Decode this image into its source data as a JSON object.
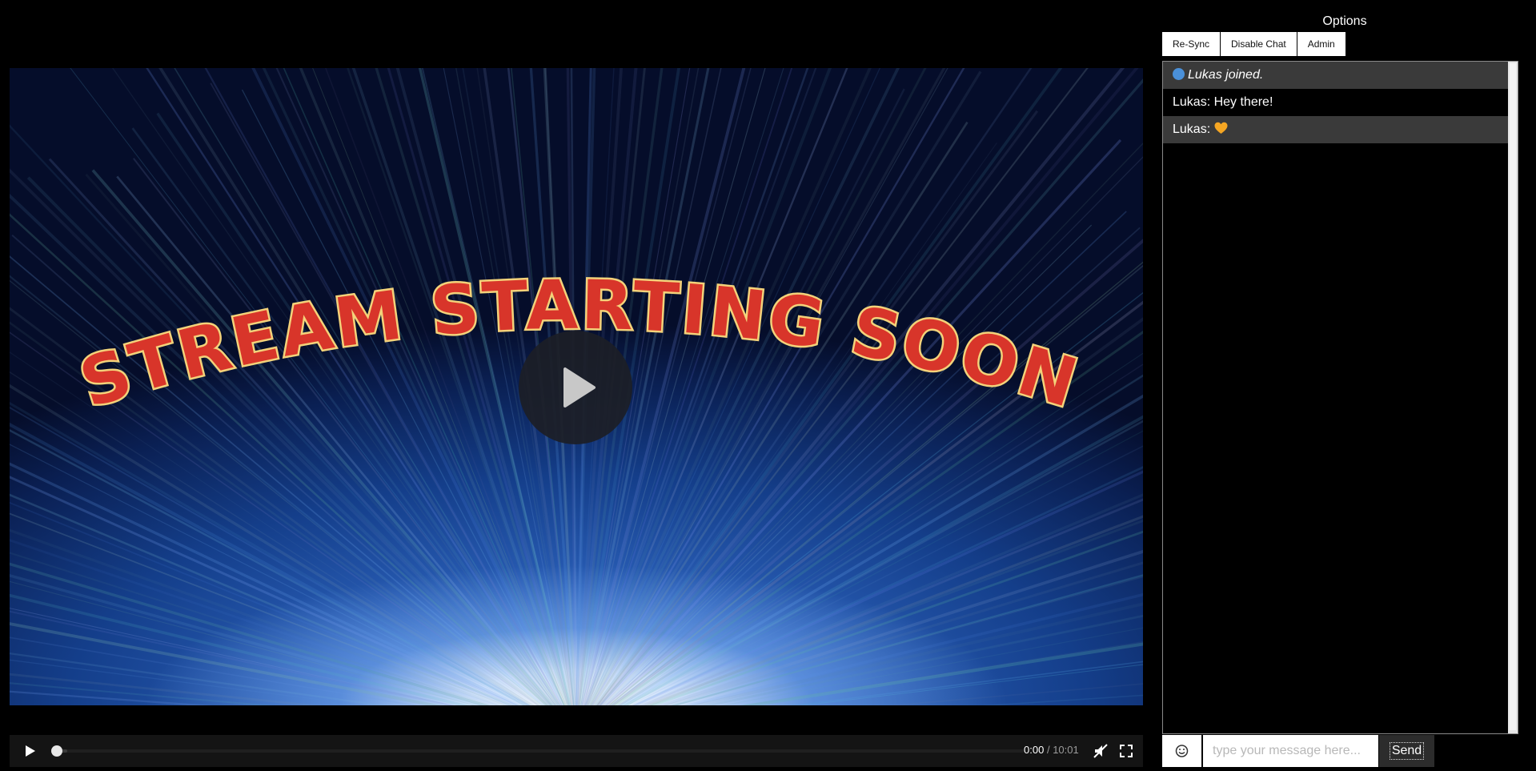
{
  "video": {
    "banner_text": "STREAM STARTING SOON",
    "time_current": "0:00",
    "time_separator": "/",
    "time_duration": "10:01",
    "progress_fraction": 0.0,
    "muted": true
  },
  "sidebar": {
    "title": "Options",
    "buttons": [
      {
        "label": "Re-Sync"
      },
      {
        "label": "Disable Chat"
      },
      {
        "label": "Admin"
      }
    ]
  },
  "chat": {
    "messages": [
      {
        "type": "system",
        "text": "Lukas joined."
      },
      {
        "type": "user",
        "text": "Lukas: Hey there!"
      },
      {
        "type": "user",
        "text": "Lukas:",
        "emoji": "orange-heart"
      }
    ],
    "input_placeholder": "type your message here...",
    "send_label": "Send"
  },
  "colors": {
    "system_dot": "#4a90d9",
    "heart": "#f5a623",
    "banner_fill": "#d8352a",
    "banner_outline": "#f3d27a"
  }
}
